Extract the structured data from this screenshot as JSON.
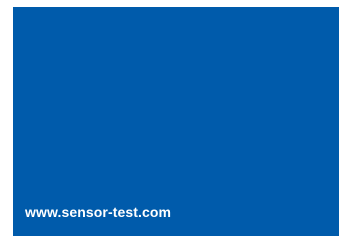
{
  "banner": {
    "url": "www.sensor-test.com",
    "background_color": "#005bab",
    "text_color": "#ffffff",
    "frame_color": "#ffffff"
  }
}
